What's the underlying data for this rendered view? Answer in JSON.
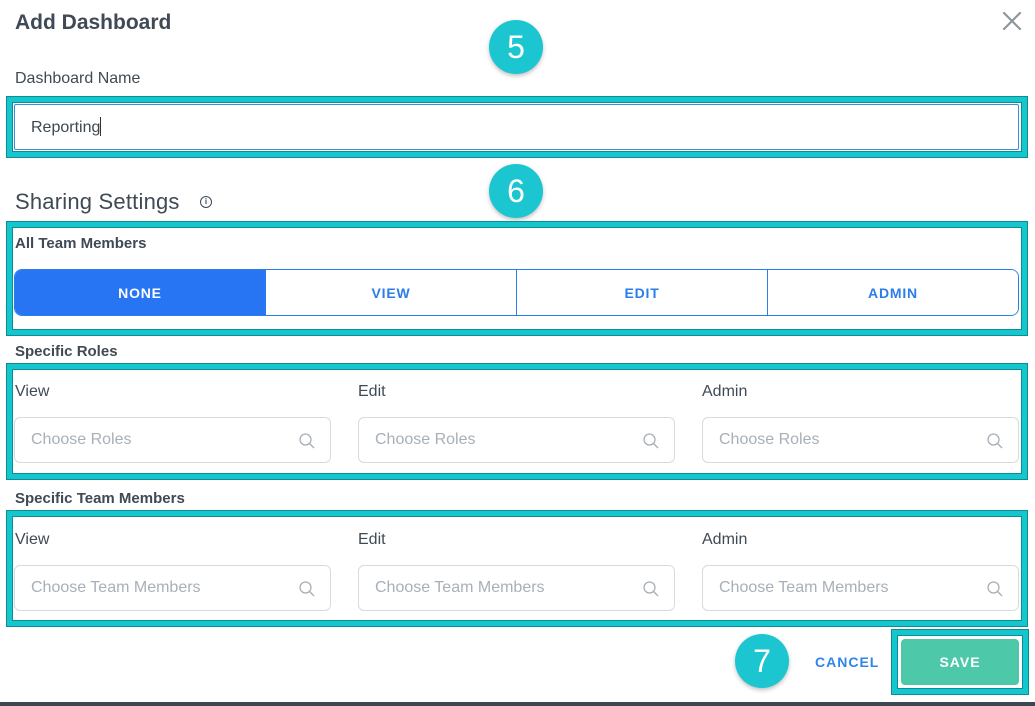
{
  "dialog": {
    "title": "Add Dashboard",
    "close_icon": "close-icon"
  },
  "annotations": {
    "step5": "5",
    "step6": "6",
    "step7": "7",
    "color": "#1cc6d1",
    "highlight_color": "#14c7cf"
  },
  "name_field": {
    "label": "Dashboard Name",
    "value": "Reporting"
  },
  "sharing": {
    "title": "Sharing Settings",
    "info_icon": "info-icon",
    "info_glyph": "i",
    "all_members": {
      "label": "All Team Members",
      "options": [
        "NONE",
        "VIEW",
        "EDIT",
        "ADMIN"
      ],
      "selected": "NONE",
      "accent": "#2875f4"
    },
    "specific_roles": {
      "label": "Specific Roles",
      "columns": [
        {
          "label": "View",
          "placeholder": "Choose Roles"
        },
        {
          "label": "Edit",
          "placeholder": "Choose Roles"
        },
        {
          "label": "Admin",
          "placeholder": "Choose Roles"
        }
      ]
    },
    "specific_members": {
      "label": "Specific Team Members",
      "columns": [
        {
          "label": "View",
          "placeholder": "Choose Team Members"
        },
        {
          "label": "Edit",
          "placeholder": "Choose Team Members"
        },
        {
          "label": "Admin",
          "placeholder": "Choose Team Members"
        }
      ]
    }
  },
  "footer": {
    "cancel_label": "CANCEL",
    "save_label": "SAVE",
    "save_color": "#4dc9a9"
  }
}
